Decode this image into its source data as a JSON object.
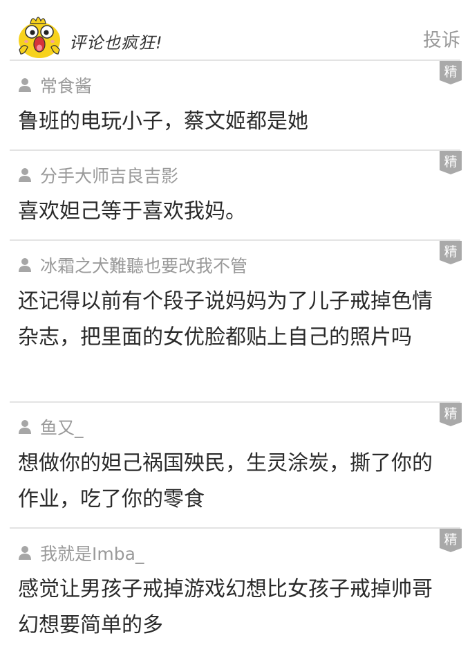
{
  "header": {
    "title": "评论也疯狂!",
    "report_label": "投诉"
  },
  "badge_label": "精",
  "comments": [
    {
      "user": "常食酱",
      "text": "鲁班的电玩小子，蔡文姬都是她"
    },
    {
      "user": "分手大师吉良吉影",
      "text": "喜欢妲己等于喜欢我妈。"
    },
    {
      "user": "冰霜之犬難聽也要改我不管",
      "text": "还记得以前有个段子说妈妈为了儿子戒掉色情杂志，把里面的女优脸都贴上自己的照片吗"
    },
    {
      "user": "鱼又_",
      "text": "想做你的妲己祸国殃民，生灵涂炭，撕了你的作业，吃了你的零食"
    },
    {
      "user": "我就是Imba_",
      "text": "感觉让男孩子戒掉游戏幻想比女孩子戒掉帅哥幻想要简单的多"
    }
  ],
  "colors": {
    "username": "#9a9a9a",
    "text": "#2a2a2a",
    "divider": "#e3e3e3",
    "badge": "#a9a9a9",
    "mascot": "#f7d21d"
  }
}
